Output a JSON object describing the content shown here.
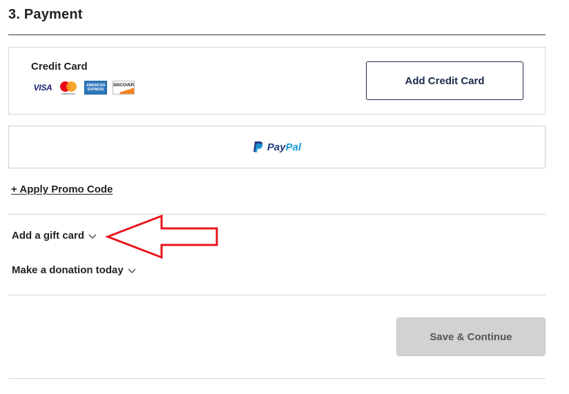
{
  "section": {
    "title": "3. Payment"
  },
  "credit_card": {
    "label": "Credit Card",
    "logos": {
      "visa": "VISA",
      "mastercard": "mastercard",
      "amex_line1": "AMERICAN",
      "amex_line2": "EXPRESS",
      "discover": "DISCOVER"
    },
    "add_button": "Add Credit Card"
  },
  "paypal": {
    "pay": "Pay",
    "pal": "Pal"
  },
  "promo": {
    "link": "+ Apply Promo Code"
  },
  "gift_card": {
    "label": "Add a gift card"
  },
  "donation": {
    "label": "Make a donation today"
  },
  "actions": {
    "save_continue": "Save & Continue"
  },
  "colors": {
    "brand_navy": "#1b2a4a",
    "paypal_dark": "#253b80",
    "paypal_light": "#179bd7",
    "annotation_red": "#e8141c",
    "disabled_button": "#d2d2d2"
  },
  "icons": {
    "chevron": "chevron-down-icon",
    "paypal": "paypal-logo-icon",
    "annotation": "red-arrow-annotation"
  }
}
